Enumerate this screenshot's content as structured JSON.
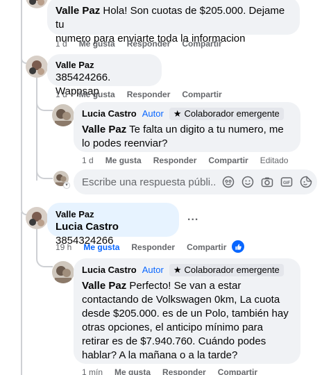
{
  "comments": {
    "top": {
      "author": "Valle Paz",
      "text": "Hola! Son cuotas de $205.000. Dejame tu numero para enviarte toda la informacion",
      "line1": "Hola! Son cuotas de $205.000. Dejame tu",
      "line2": "numero para enviarte toda la informacion",
      "time": "1 d",
      "like": "Me gusta",
      "reply": "Responder",
      "share": "Compartir"
    },
    "second": {
      "author": "Valle Paz",
      "text": "385424266. Wappsap",
      "time": "1 d",
      "like": "Me gusta",
      "reply": "Responder",
      "share": "Compartir"
    },
    "reply1": {
      "author": "Lucia Castro",
      "role": "Autor",
      "badge": "Colaborador emergente",
      "mention": "Valle Paz",
      "line1": "Te falta un digito a tu numero, me",
      "line2": "lo podes reenviar?",
      "time": "1 d",
      "like": "Me gusta",
      "reply": "Responder",
      "share": "Compartir",
      "edited": "Editado"
    },
    "reply_box": {
      "placeholder": "Escribe una respuesta públi..."
    },
    "third": {
      "author": "Valle Paz",
      "mention": "Lucia Castro",
      "text": "3854324266",
      "more": "...",
      "time": "19 h",
      "like": "Me gusta",
      "reply": "Responder",
      "share": "Compartir"
    },
    "reply2": {
      "author": "Lucia Castro",
      "role": "Autor",
      "badge": "Colaborador emergente",
      "mention": "Valle Paz",
      "line1": "Perfecto! Se van a estar",
      "line2": "contactando de Volkswagen 0km, La cuota",
      "line3": "desde $205.000. es de un Polo, también hay",
      "line4": "otras opciones, el anticipo mínimo para",
      "line5": "retirar es de $7.940.760. Cuándo podes",
      "line6": "hablar? A la mañana o a la tarde?",
      "time": "1 mín",
      "like": "Me gusta",
      "reply": "Responder",
      "share": "Compartir"
    }
  },
  "colors": {
    "accent": "#0866ff",
    "bubble": "#f0f2f5",
    "highlight_bubble": "#e7f3ff",
    "meta": "#65676b"
  }
}
